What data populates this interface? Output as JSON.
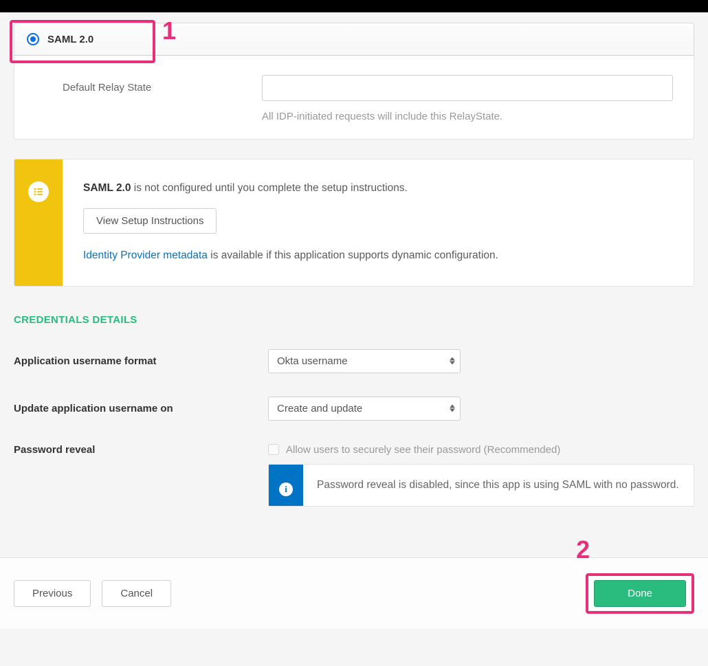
{
  "radio": {
    "label": "SAML 2.0",
    "annotation_number": "1"
  },
  "relay": {
    "label": "Default Relay State",
    "value": "",
    "hint": "All IDP-initiated requests will include this RelayState."
  },
  "setup": {
    "strong": "SAML 2.0",
    "text": " is not configured until you complete the setup instructions.",
    "button": "View Setup Instructions",
    "linkText": "Identity Provider metadata",
    "afterLink": " is available if this application supports dynamic configuration."
  },
  "credentials": {
    "title": "CREDENTIALS DETAILS",
    "username_format": {
      "label": "Application username format",
      "value": "Okta username"
    },
    "update_on": {
      "label": "Update application username on",
      "value": "Create and update"
    },
    "password_reveal": {
      "label": "Password reveal",
      "checkbox_label": "Allow users to securely see their password (Recommended)",
      "info": "Password reveal is disabled, since this app is using SAML with no password."
    }
  },
  "footer": {
    "previous": "Previous",
    "cancel": "Cancel",
    "done": "Done",
    "done_annotation": "2"
  }
}
